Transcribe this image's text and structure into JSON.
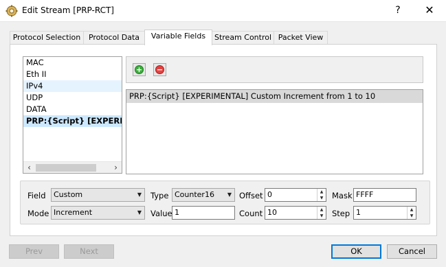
{
  "window": {
    "title": "Edit Stream [PRP-RCT]",
    "help_glyph": "?",
    "close_glyph": "✕"
  },
  "tabs": [
    {
      "label": "Protocol Selection",
      "active": false
    },
    {
      "label": "Protocol Data",
      "active": false
    },
    {
      "label": "Variable Fields",
      "active": true
    },
    {
      "label": "Stream Control",
      "active": false
    },
    {
      "label": "Packet View",
      "active": false
    }
  ],
  "protocols": [
    {
      "label": "MAC",
      "state": "normal"
    },
    {
      "label": "Eth II",
      "state": "normal"
    },
    {
      "label": "IPv4",
      "state": "highlight"
    },
    {
      "label": "UDP",
      "state": "normal"
    },
    {
      "label": "DATA",
      "state": "normal"
    },
    {
      "label": "PRP:{Script} [EXPERIMENTAL]",
      "state": "selected"
    }
  ],
  "toolbar": {
    "add_icon": "add-circle-icon",
    "remove_icon": "remove-circle-icon"
  },
  "variable_fields": [
    "PRP:{Script} [EXPERIMENTAL] Custom Increment from 1 to 10"
  ],
  "form": {
    "field_label": "Field",
    "field_value": "Custom",
    "type_label": "Type",
    "type_value": "Counter16",
    "offset_label": "Offset",
    "offset_value": "0",
    "mask_label": "Mask",
    "mask_value": "FFFF",
    "mode_label": "Mode",
    "mode_value": "Increment",
    "value_label": "Value",
    "value_value": "1",
    "count_label": "Count",
    "count_value": "10",
    "step_label": "Step",
    "step_value": "1"
  },
  "buttons": {
    "prev": "Prev",
    "next": "Next",
    "ok": "OK",
    "cancel": "Cancel"
  },
  "colors": {
    "selection": "#cce8ff",
    "default_button_border": "#0078d7",
    "add": "#3cae3c",
    "remove": "#e34242"
  }
}
